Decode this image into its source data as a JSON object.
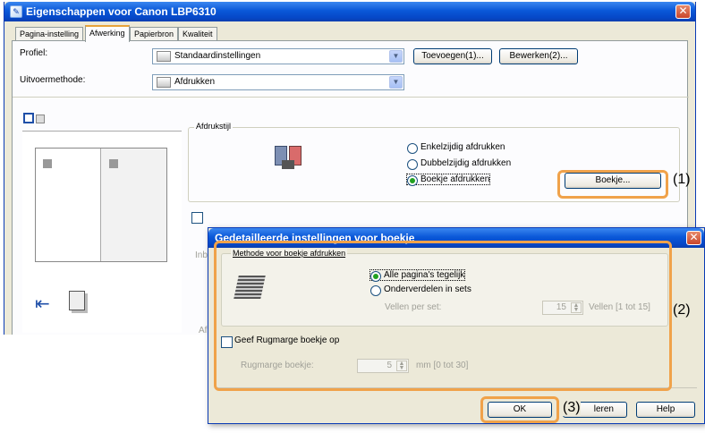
{
  "main_window": {
    "title": "Eigenschappen voor Canon LBP6310",
    "tabs": [
      {
        "label": "Pagina-instelling",
        "active": false
      },
      {
        "label": "Afwerking",
        "active": true
      },
      {
        "label": "Papierbron",
        "active": false
      },
      {
        "label": "Kwaliteit",
        "active": false
      }
    ],
    "profile_label": "Profiel:",
    "profile_value": "Standaardinstellingen",
    "add_button": "Toevoegen(1)...",
    "edit_button": "Bewerken(2)...",
    "output_method_label": "Uitvoermethode:",
    "output_method_value": "Afdrukken",
    "print_style_group": "Afdrukstijl",
    "print_style_options": [
      {
        "label": "Enkelzijdig afdrukken",
        "checked": false
      },
      {
        "label": "Dubbelzijdig afdrukken",
        "checked": false
      },
      {
        "label": "Boekje afdrukken",
        "checked": true
      }
    ],
    "booklet_button": "Boekje...",
    "partial_label_binding": "Inbi",
    "partial_label_a": "Af"
  },
  "dialog": {
    "title": "Gedetailleerde instellingen voor boekje",
    "method_group": "Methode voor boekje afdrukken",
    "method_options": [
      {
        "label": "Alle pagina's tegelijk",
        "checked": true
      },
      {
        "label": "Onderverdelen in sets",
        "checked": false
      }
    ],
    "sheets_per_set_label": "Vellen per set:",
    "sheets_per_set_value": "15",
    "sheets_range": "Vellen [1 tot 15]",
    "gutter_checkbox": "Geef Rugmarge boekje op",
    "gutter_checked": false,
    "gutter_label": "Rugmarge boekje:",
    "gutter_value": "5",
    "gutter_range": "mm [0 tot 30]",
    "ok_button": "OK",
    "cancel_button_partial": "leren",
    "help_button": "Help"
  },
  "callouts": [
    "(1)",
    "(2)",
    "(3)"
  ],
  "colors": {
    "titlebar": "#0a58d8",
    "callout_border": "#f0a24a",
    "dialog_bg": "#ece9d8"
  }
}
